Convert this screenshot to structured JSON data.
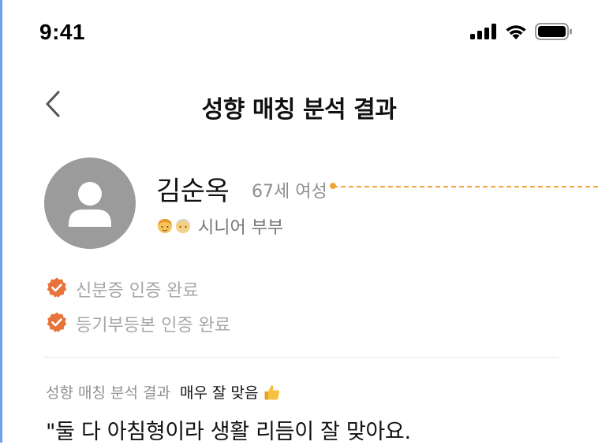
{
  "status_bar": {
    "time": "9:41",
    "icons": [
      "signal-icon",
      "wifi-icon",
      "battery-icon"
    ]
  },
  "nav": {
    "back_icon": "chevron-left-icon",
    "title": "성향 매칭 분석 결과"
  },
  "profile": {
    "avatar_icon": "person-icon",
    "name": "김순옥",
    "age_gender": "67세 여성",
    "type_emojis": [
      "older-woman-emoji",
      "older-man-emoji"
    ],
    "type_label": "시니어 부부"
  },
  "verifications": [
    {
      "icon": "verified-badge-icon",
      "label": "신분증 인증 완료"
    },
    {
      "icon": "verified-badge-icon",
      "label": "등기부등본 인증 완료"
    }
  ],
  "result": {
    "label": "성향 매칭 분석 결과",
    "value": "매우 잘 맞음",
    "value_icon": "thumbs-up-emoji",
    "quote": "\"둘 다 아침형이라 생활 리듬이 잘 맞아요."
  },
  "colors": {
    "accent_orange": "#e8743b",
    "dotted_line": "#f2a43a",
    "avatar_gray": "#9b9b9b",
    "frame_blue": "#6aa0ec"
  }
}
